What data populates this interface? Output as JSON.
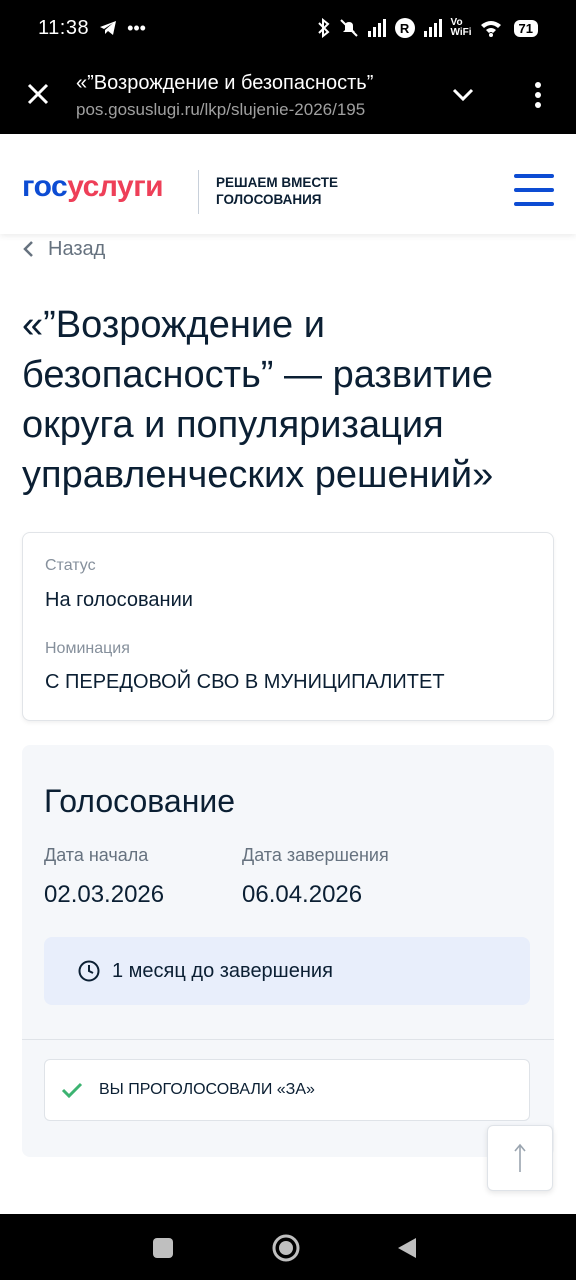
{
  "status_bar": {
    "time": "11:38",
    "battery": "71",
    "roaming_badge": "R",
    "vowifi_line1": "Vo",
    "vowifi_line2": "WiFi"
  },
  "browser": {
    "page_title": "«”Возрождение и безопасность”",
    "url": "pos.gosuslugi.ru/lkp/slujenie-2026/195"
  },
  "site_header": {
    "logo_part1": "гос",
    "logo_part2": "услуги",
    "tagline_line1": "РЕШАЕМ ВМЕСТЕ",
    "tagline_line2": "ГОЛОСОВАНИЯ"
  },
  "back_label": "Назад",
  "title": "«”Возрождение и безопасность” — развитие округа и популяризация управленческих решений»",
  "info": {
    "status_label": "Статус",
    "status_value": "На голосовании",
    "nomination_label": "Номинация",
    "nomination_value": "С ПЕРЕДОВОЙ СВО В МУНИЦИПАЛИТЕТ"
  },
  "voting": {
    "heading": "Голосование",
    "start_label": "Дата начала",
    "start_value": "02.03.2026",
    "end_label": "Дата завершения",
    "end_value": "06.04.2026",
    "remaining": "1 месяц до завершения",
    "voted_status": "ВЫ ПРОГОЛОСОВАЛИ «ЗА»"
  },
  "colors": {
    "brand_blue": "#0d4cd3",
    "brand_red": "#ee3f58",
    "check_green": "#3cb371"
  }
}
